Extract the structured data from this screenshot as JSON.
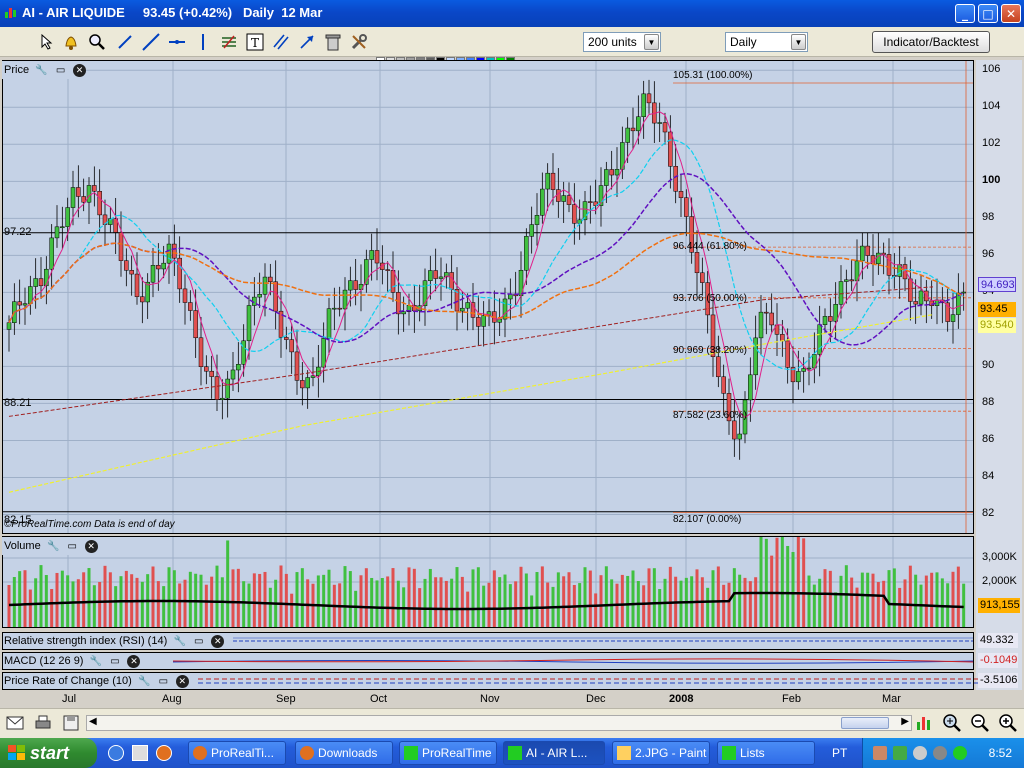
{
  "window": {
    "title": "AI - AIR LIQUIDE     93.45 (+0.42%)   Daily  12 Mar",
    "min_label": "_",
    "max_label": "□",
    "close_label": "✕"
  },
  "toolbar": {
    "units_value": "200 units",
    "period_value": "Daily",
    "indicator_button": "Indicator/Backtest",
    "palette": [
      "#ffffff",
      "#e0e0e0",
      "#c0c0c0",
      "#a0a0a0",
      "#808080",
      "#606060",
      "#000000",
      "#c0d8ff",
      "#80b0ff",
      "#4080ff",
      "#0000ff",
      "#00c0c0",
      "#00ff00",
      "#008000",
      "#ffe0e0",
      "#ffc0c0",
      "#ff8080",
      "#ff0000",
      "#c00000",
      "#ff80ff",
      "#ffff80",
      "#ffff00",
      "#c0c000",
      "#80ff80",
      "#40c040",
      "#00ffff",
      "#0080ff",
      "#8000ff"
    ]
  },
  "price_pane": {
    "label": "Price",
    "left_labels": {
      "top": "97.22",
      "mid": "88.21",
      "bottom": "82.15"
    },
    "watermark": "©ProRealTime.com   Data is end of day",
    "fib_labels": [
      "105.31 (100.00%)",
      "96.444 (61.80%)",
      "93.706 (50.00%)",
      "90.969 (38.20%)",
      "87.582 (23.60%)",
      "82.107 (0.00%)"
    ],
    "axis_ticks": [
      "106",
      "104",
      "102",
      "100",
      "98",
      "96",
      "94",
      "92",
      "90",
      "88",
      "86",
      "84",
      "82"
    ],
    "tags": {
      "ma": "94.693",
      "price": "93.45",
      "ma2": "93.540"
    }
  },
  "volume_pane": {
    "label": "Volume",
    "axis_ticks": [
      "3,000K",
      "2,000K"
    ],
    "tag": "913,155"
  },
  "indicators": [
    {
      "label": "Relative strength index (RSI) (14)",
      "value": "49.332",
      "color": "#000000"
    },
    {
      "label": "MACD (12 26 9)",
      "value": "-0.1049",
      "color": "#d02020"
    },
    {
      "label": "Price Rate of Change (10)",
      "value": "-3.5106",
      "color": "#000000"
    }
  ],
  "date_axis": [
    "Jul",
    "Aug",
    "Sep",
    "Oct",
    "Nov",
    "Dec",
    "2008",
    "Jan",
    "Feb",
    "Mar"
  ],
  "taskbar": {
    "start": "start",
    "tasks": [
      "ProRealTi...",
      "Downloads",
      "ProRealTime",
      "AI - AIR L...",
      "2.JPG - Paint",
      "Lists"
    ],
    "lang": "PT",
    "clock": "8:52"
  },
  "chart_data": {
    "type": "candlestick",
    "title": "AI - AIR LIQUIDE",
    "ylim": [
      81,
      106.5
    ],
    "x_months": [
      "Jul",
      "Aug",
      "Sep",
      "Oct",
      "Nov",
      "Dec",
      "2008",
      "Feb",
      "Mar"
    ],
    "close_series_approx": [
      92,
      94,
      95,
      97,
      99,
      100,
      98,
      96,
      94,
      95,
      96,
      94,
      91,
      88,
      89,
      93,
      95,
      92,
      90,
      89,
      92,
      94,
      95,
      96,
      94,
      93,
      94,
      95,
      94,
      93,
      92,
      93,
      95,
      98,
      100,
      99,
      98,
      99,
      101,
      103,
      104,
      103,
      100,
      96,
      92,
      88,
      86,
      92,
      93,
      90,
      89,
      92,
      94,
      95,
      96,
      96,
      95,
      93,
      94,
      93,
      93.45
    ],
    "levels": [
      97.22,
      88.21,
      82.15
    ],
    "fibonacci": [
      {
        "label": "100.00%",
        "value": 105.31
      },
      {
        "label": "61.80%",
        "value": 96.444
      },
      {
        "label": "50.00%",
        "value": 93.706
      },
      {
        "label": "38.20%",
        "value": 90.969
      },
      {
        "label": "23.60%",
        "value": 87.582
      },
      {
        "label": "0.00%",
        "value": 82.107
      }
    ],
    "last_price": 93.45,
    "change_pct": 0.42
  }
}
